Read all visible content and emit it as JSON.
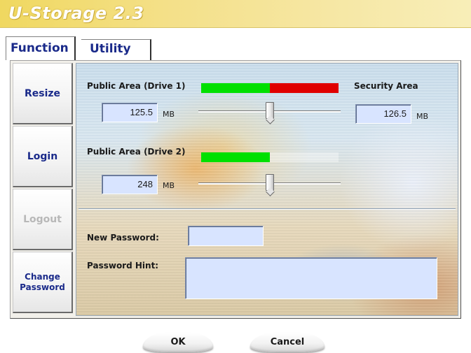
{
  "window": {
    "title": "U-Storage 2.3"
  },
  "tabs": [
    {
      "label": "Function",
      "active": true
    },
    {
      "label": "Utility",
      "active": false
    }
  ],
  "sidebar": {
    "items": [
      {
        "label": "Resize",
        "enabled": true
      },
      {
        "label": "Login",
        "enabled": true
      },
      {
        "label": "Logout",
        "enabled": false
      },
      {
        "label": "Change Password",
        "enabled": true
      }
    ]
  },
  "resize": {
    "drive1": {
      "label": "Public Area (Drive 1)",
      "value": "125.5",
      "unit": "MB",
      "bar_fraction": 0.5,
      "slider_fraction": 0.5
    },
    "security": {
      "label": "Security Area",
      "value": "126.5",
      "unit": "MB"
    },
    "drive2": {
      "label": "Public Area (Drive 2)",
      "value": "248",
      "unit": "MB",
      "bar_fraction": 0.5,
      "slider_fraction": 0.5
    }
  },
  "password": {
    "new_label": "New Password:",
    "new_value": "",
    "hint_label": "Password Hint:",
    "hint_value": ""
  },
  "footer": {
    "ok_label": "OK",
    "cancel_label": "Cancel"
  },
  "colors": {
    "title_bar": "#f0d860",
    "nav_text": "#1a2a8a",
    "public_bar": "#00e000",
    "security_bar": "#e00000",
    "field_fill": "#d8e4ff"
  }
}
